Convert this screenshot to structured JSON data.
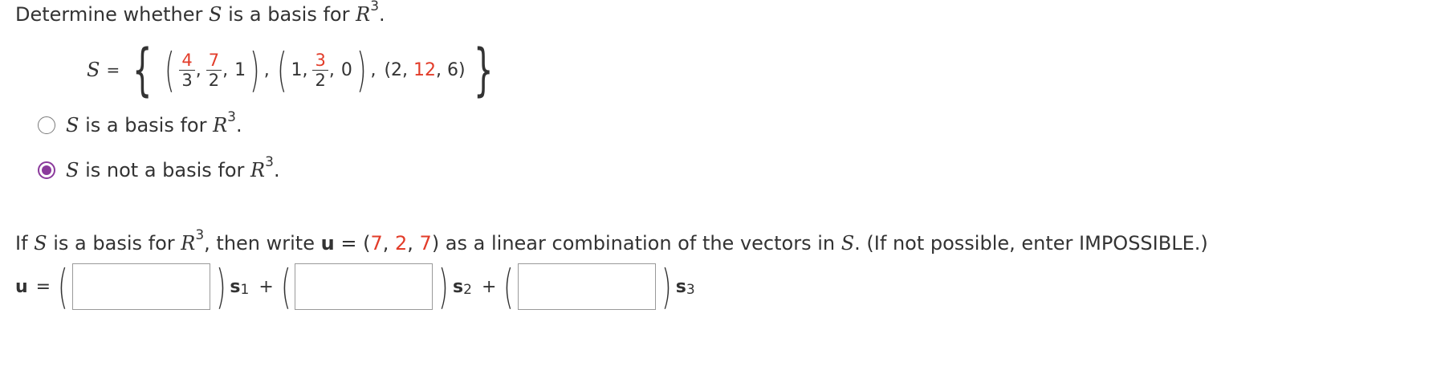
{
  "question1": {
    "prefix": "Determine whether ",
    "S": "S",
    "middle": " is a basis for ",
    "R": "R",
    "exp": "3",
    "suffix": "."
  },
  "set": {
    "S": "S",
    "eq": "=",
    "v1": {
      "a_num": "4",
      "a_den": "3",
      "b_num": "7",
      "b_den": "2",
      "c": "1"
    },
    "v2": {
      "a": "1",
      "b_num": "3",
      "b_den": "2",
      "c": "0"
    },
    "v3": {
      "a": "2",
      "b": "12",
      "c": "6"
    },
    "comma": ","
  },
  "options": [
    {
      "S": "S",
      "text": " is a basis for ",
      "R": "R",
      "exp": "3",
      "end": ".",
      "selected": false
    },
    {
      "S": "S",
      "text": " is not a basis for ",
      "R": "R",
      "exp": "3",
      "end": ".",
      "selected": true
    }
  ],
  "question2": {
    "p1": "If ",
    "S": "S",
    "p2": " is a basis for ",
    "R": "R",
    "exp": "3",
    "p3": ", then write ",
    "u": "u",
    "p4": " = (",
    "u1": "7",
    "c1": ", ",
    "u2": "2",
    "c2": ", ",
    "u3": "7",
    "p5": ") as a linear combination of the vectors in ",
    "S2": "S",
    "p6": ". (If not possible, enter IMPOSSIBLE.)"
  },
  "combination": {
    "u": "u",
    "eq": "=",
    "s": "s",
    "sub1": "1",
    "sub2": "2",
    "sub3": "3",
    "plus": "+",
    "inputs": [
      "",
      "",
      ""
    ]
  },
  "colors": {
    "accent": "#8b3a9c",
    "highlight": "#e23c29"
  }
}
